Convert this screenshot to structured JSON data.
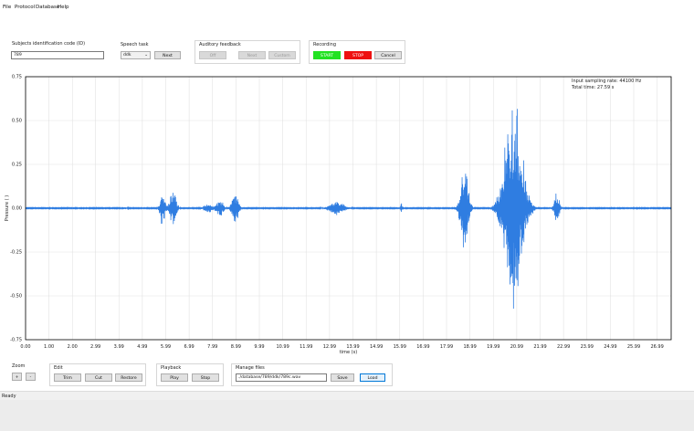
{
  "menu": [
    "File",
    "Protocol",
    "Database",
    "Help"
  ],
  "subject": {
    "label": "Subjects identification code (ID)",
    "value": "789"
  },
  "speech_task": {
    "label": "Speech task",
    "selected": "ddk",
    "next_label": "Next"
  },
  "auditory": {
    "label": "Auditory feedback",
    "off_label": "Off",
    "next_label": "Next",
    "custom_label": "Custom"
  },
  "recording": {
    "label": "Recording",
    "start_label": "START",
    "stop_label": "STOP",
    "cancel_label": "Cancel",
    "start_color": "#22e222",
    "stop_color": "#ee1111"
  },
  "plot_info": {
    "line1": "Input sampling rate: 44100 Hz",
    "line2": "Total time: 27.59 s"
  },
  "chart_data": {
    "type": "line",
    "title": "",
    "xlabel": "time (s)",
    "ylabel": "Pressure ( )",
    "xlim": [
      0,
      27.59
    ],
    "ylim": [
      -0.75,
      0.75
    ],
    "grid": true,
    "line_color": "#2f7de1",
    "x_ticks": [
      "0.00",
      "1.00",
      "2.00",
      "2.99",
      "3.99",
      "4.99",
      "5.99",
      "6.99",
      "7.99",
      "8.99",
      "9.99",
      "10.99",
      "11.99",
      "12.99",
      "13.99",
      "14.99",
      "15.99",
      "16.99",
      "17.99",
      "18.99",
      "19.99",
      "20.99",
      "21.99",
      "22.99",
      "23.99",
      "24.99",
      "25.99",
      "26.99"
    ],
    "x_tick_values": [
      0,
      1,
      2,
      2.99,
      3.99,
      4.99,
      5.99,
      6.99,
      7.99,
      8.99,
      9.99,
      10.99,
      11.99,
      12.99,
      13.99,
      14.99,
      15.99,
      16.99,
      17.99,
      18.99,
      19.99,
      20.99,
      21.99,
      22.99,
      23.99,
      24.99,
      25.99,
      26.99
    ],
    "y_ticks": [
      "0.75",
      "0.50",
      "0.25",
      "0.00",
      "-0.25",
      "-0.50",
      "-0.75"
    ],
    "y_tick_values": [
      0.75,
      0.5,
      0.25,
      0,
      -0.25,
      -0.5,
      -0.75
    ],
    "bursts": [
      {
        "t": 4.2,
        "amp": 0.008,
        "dur": 0.3
      },
      {
        "t": 5.85,
        "amp": 0.11,
        "dur": 0.3
      },
      {
        "t": 6.3,
        "amp": 0.12,
        "dur": 0.4
      },
      {
        "t": 7.8,
        "amp": 0.03,
        "dur": 0.5
      },
      {
        "t": 8.3,
        "amp": 0.06,
        "dur": 0.4
      },
      {
        "t": 8.95,
        "amp": 0.11,
        "dur": 0.4
      },
      {
        "t": 13.3,
        "amp": 0.04,
        "dur": 0.9
      },
      {
        "t": 16.05,
        "amp": 0.05,
        "dur": 0.08
      },
      {
        "t": 18.75,
        "amp": 0.27,
        "dur": 0.5
      },
      {
        "t": 20.85,
        "amp": 0.66,
        "dur": 1.2
      },
      {
        "t": 22.7,
        "amp": 0.09,
        "dur": 0.35
      }
    ]
  },
  "zoom": {
    "label": "Zoom",
    "plus": "+",
    "minus": "-"
  },
  "edit": {
    "label": "Edit",
    "trim": "Trim",
    "cut": "Cut",
    "restore": "Restore"
  },
  "playback": {
    "label": "Playback",
    "play": "Play",
    "stop": "Stop"
  },
  "files": {
    "label": "Manage files",
    "path": "./database/789/ddk/789c.wav",
    "save": "Save",
    "load": "Load"
  },
  "status": {
    "text": "Ready"
  }
}
